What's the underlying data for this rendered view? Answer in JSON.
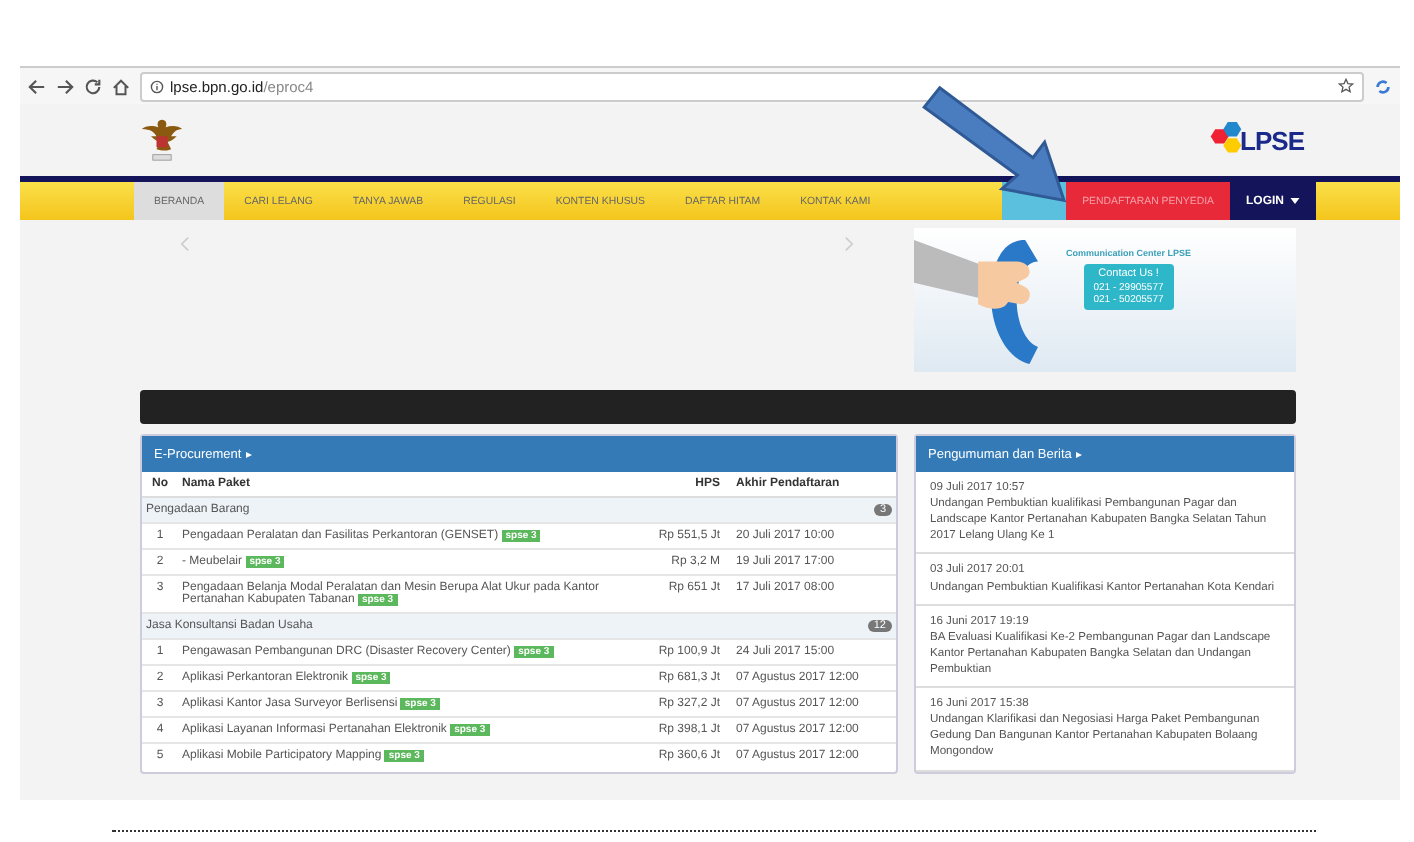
{
  "browser": {
    "url_host": "lpse.bpn.go.id",
    "url_path": "/eproc4"
  },
  "logo_text": "LPSE",
  "nav": [
    {
      "label": "BERANDA",
      "selected": true
    },
    {
      "label": "CARI LELANG",
      "selected": false
    },
    {
      "label": "TANYA JAWAB",
      "selected": false
    },
    {
      "label": "REGULASI",
      "selected": false
    },
    {
      "label": "KONTEN KHUSUS",
      "selected": false
    },
    {
      "label": "DAFTAR HITAM",
      "selected": false
    },
    {
      "label": "KONTAK KAMI",
      "selected": false
    }
  ],
  "nav_actions": [
    {
      "kind": "info"
    },
    {
      "kind": "register",
      "label": "PENDAFTARAN PENYEDIA"
    },
    {
      "kind": "login",
      "label": "LOGIN"
    }
  ],
  "banner": {
    "title": "Communication Center LPSE",
    "heading": "Contact Us !",
    "phones": [
      "021 - 29905577",
      "021 - 50205577"
    ]
  },
  "procurement": {
    "title": "E-Procurement",
    "columns": [
      "No",
      "Nama Paket",
      "HPS",
      "Akhir Pendaftaran"
    ],
    "groups": [
      {
        "name": "Pengadaan Barang",
        "count": "3",
        "rows": [
          {
            "no": "1",
            "name": "Pengadaan Peralatan dan Fasilitas Perkantoran (GENSET)",
            "tag": "spse 3",
            "hps": "Rp 551,5 Jt",
            "deadline": "20 Juli 2017 10:00"
          },
          {
            "no": "2",
            "name": "- Meubelair",
            "tag": "spse 3",
            "hps": "Rp 3,2 M",
            "deadline": "19 Juli 2017 17:00"
          },
          {
            "no": "3",
            "name": "Pengadaan Belanja Modal Peralatan dan Mesin Berupa Alat Ukur pada Kantor Pertanahan Kabupaten Tabanan",
            "tag": "spse 3",
            "hps": "Rp 651 Jt",
            "deadline": "17 Juli 2017 08:00"
          }
        ]
      },
      {
        "name": "Jasa Konsultansi Badan Usaha",
        "count": "12",
        "rows": [
          {
            "no": "1",
            "name": "Pengawasan Pembangunan DRC (Disaster Recovery Center)",
            "tag": "spse 3",
            "hps": "Rp 100,9 Jt",
            "deadline": "24 Juli 2017 15:00"
          },
          {
            "no": "2",
            "name": "Aplikasi Perkantoran Elektronik",
            "tag": "spse 3",
            "hps": "Rp 681,3 Jt",
            "deadline": "07 Agustus 2017 12:00"
          },
          {
            "no": "3",
            "name": "Aplikasi Kantor Jasa Surveyor Berlisensi",
            "tag": "spse 3",
            "hps": "Rp 327,2 Jt",
            "deadline": "07 Agustus 2017 12:00"
          },
          {
            "no": "4",
            "name": "Aplikasi Layanan Informasi Pertanahan Elektronik",
            "tag": "spse 3",
            "hps": "Rp 398,1 Jt",
            "deadline": "07 Agustus 2017 12:00"
          },
          {
            "no": "5",
            "name": "Aplikasi Mobile Participatory Mapping",
            "tag": "spse 3",
            "hps": "Rp 360,6 Jt",
            "deadline": "07 Agustus 2017 12:00"
          }
        ]
      }
    ]
  },
  "news": {
    "title": "Pengumuman dan Berita",
    "items": [
      {
        "date": "09 Juli 2017 10:57",
        "text": "Undangan Pembuktian kualifikasi Pembangunan Pagar dan Landscape Kantor Pertanahan Kabupaten Bangka Selatan Tahun 2017 Lelang Ulang Ke 1"
      },
      {
        "date": "03 Juli 2017 20:01",
        "text": "Undangan Pembuktian Kualifikasi Kantor Pertanahan Kota Kendari"
      },
      {
        "date": "16 Juni 2017 19:19",
        "text": "BA Evaluasi Kualifikasi Ke-2 Pembangunan Pagar dan Landscape Kantor Pertanahan Kabupaten Bangka Selatan dan Undangan Pembuktian"
      },
      {
        "date": "16 Juni 2017 15:38",
        "text": "Undangan Klarifikasi dan Negosiasi Harga Paket Pembangunan Gedung Dan Bangunan Kantor Pertanahan Kabupaten Bolaang Mongondow"
      }
    ]
  }
}
